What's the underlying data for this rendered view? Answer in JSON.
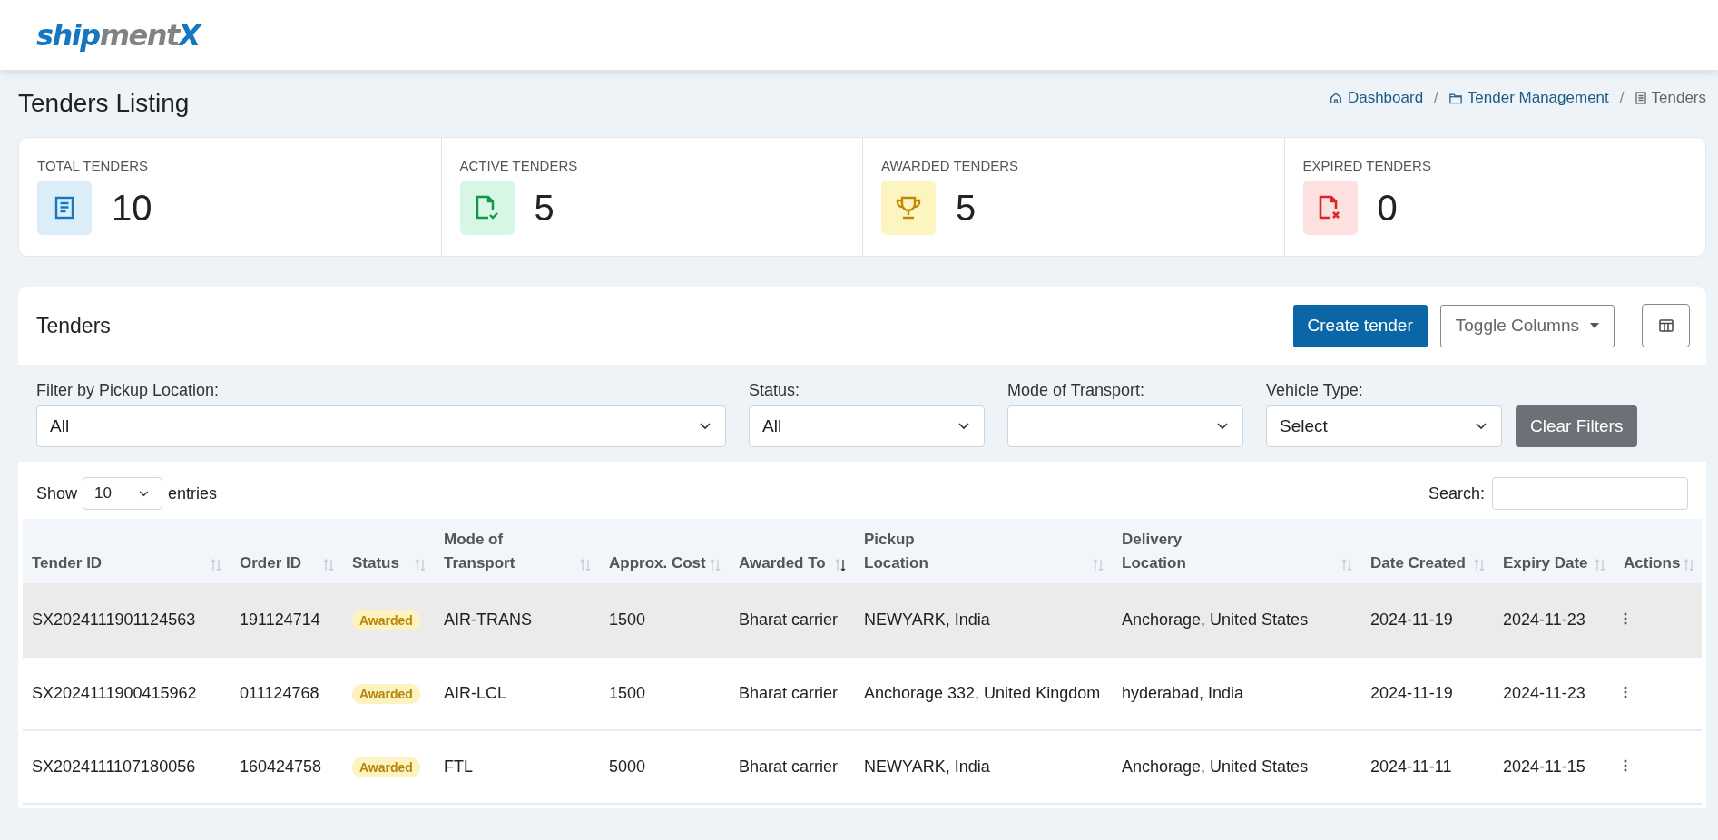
{
  "logo": {
    "parts": [
      {
        "text": "ship",
        "kind": "accent"
      },
      {
        "text": "ment",
        "kind": "muted"
      },
      {
        "text": "X",
        "kind": "accent"
      }
    ]
  },
  "page_title": "Tenders Listing",
  "breadcrumb": [
    {
      "label": "Dashboard",
      "current": false
    },
    {
      "label": "Tender Management",
      "current": false
    },
    {
      "label": "Tenders",
      "current": true
    }
  ],
  "breadcrumb_separator": "/",
  "stats": [
    {
      "label": "TOTAL TENDERS",
      "value": "10",
      "kind": "total"
    },
    {
      "label": "ACTIVE TENDERS",
      "value": "5",
      "kind": "active"
    },
    {
      "label": "AWARDED TENDERS",
      "value": "5",
      "kind": "awarded"
    },
    {
      "label": "EXPIRED TENDERS",
      "value": "0",
      "kind": "expired"
    }
  ],
  "panel": {
    "title": "Tenders",
    "create_button": "Create tender",
    "toggle_button": "Toggle Columns"
  },
  "filters": [
    {
      "label": "Filter by Pickup Location:",
      "value": "All",
      "kind": "wide"
    },
    {
      "label": "Status:",
      "value": "All",
      "kind": "narrow"
    },
    {
      "label": "Mode of Transport:",
      "kind": "narrow"
    },
    {
      "label": "Vehicle Type:",
      "value": "Select",
      "kind": "narrow"
    }
  ],
  "clear_button": "Clear Filters",
  "table": {
    "show_label": "Show",
    "page_size": "10",
    "entries_label": "entries",
    "search_label": "Search:",
    "columns": [
      {
        "label": "Tender ID",
        "sorted": false
      },
      {
        "label": "Order ID",
        "sorted": false
      },
      {
        "label": "Status",
        "sorted": false
      },
      {
        "label": "Mode of Transport",
        "sorted": false
      },
      {
        "label": "Approx. Cost",
        "sorted": false
      },
      {
        "label": "Awarded To",
        "sorted": true
      },
      {
        "label": "Pickup Location",
        "sorted": false
      },
      {
        "label": "Delivery Location",
        "sorted": false
      },
      {
        "label": "Date Created",
        "sorted": false
      },
      {
        "label": "Expiry Date",
        "sorted": false
      },
      {
        "label": "Actions",
        "sorted": false
      }
    ],
    "rows": [
      {
        "highlighted": true,
        "tender_id": "SX2024111901124563",
        "order_id": "191124714",
        "status": "Awarded",
        "mode": "AIR-TRANS",
        "cost": "1500",
        "awarded_to": "Bharat carrier",
        "pickup": "NEWYARK, India",
        "delivery": "Anchorage, United States",
        "created": "2024-11-19",
        "expiry": "2024-11-23"
      },
      {
        "highlighted": false,
        "tender_id": "SX2024111900415962",
        "order_id": "011124768",
        "status": "Awarded",
        "mode": "AIR-LCL",
        "cost": "1500",
        "awarded_to": "Bharat carrier",
        "pickup": "Anchorage 332, United Kingdom",
        "delivery": "hyderabad, India",
        "created": "2024-11-19",
        "expiry": "2024-11-23"
      },
      {
        "highlighted": false,
        "tender_id": "SX2024111107180056",
        "order_id": "160424758",
        "status": "Awarded",
        "mode": "FTL",
        "cost": "5000",
        "awarded_to": "Bharat carrier",
        "pickup": "NEWYARK, India",
        "delivery": "Anchorage, United States",
        "created": "2024-11-11",
        "expiry": "2024-11-15"
      }
    ]
  }
}
